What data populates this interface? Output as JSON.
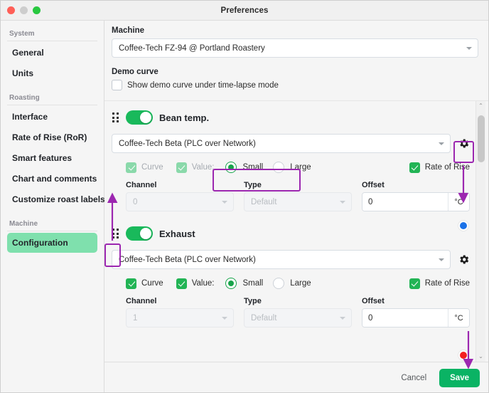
{
  "window": {
    "title": "Preferences",
    "controls": [
      "close-red",
      "minimize-grey",
      "zoom-green"
    ]
  },
  "sidebar": {
    "groups": [
      {
        "label": "System",
        "items": [
          {
            "label": "General",
            "active": false
          },
          {
            "label": "Units",
            "active": false
          }
        ]
      },
      {
        "label": "Roasting",
        "items": [
          {
            "label": "Interface",
            "active": false
          },
          {
            "label": "Rate of Rise (RoR)",
            "active": false
          },
          {
            "label": "Smart features",
            "active": false
          },
          {
            "label": "Chart and comments",
            "active": false
          },
          {
            "label": "Customize roast labels",
            "active": false
          }
        ]
      },
      {
        "label": "Machine",
        "items": [
          {
            "label": "Configuration",
            "active": true
          }
        ]
      }
    ]
  },
  "main": {
    "machine": {
      "label": "Machine",
      "value": "Coffee-Tech FZ-94 @ Portland Roastery"
    },
    "demo": {
      "label": "Demo curve",
      "checkbox_label": "Show demo curve under time-lapse mode",
      "checked": false
    }
  },
  "devices": [
    {
      "name": "Bean temp.",
      "enabled": true,
      "source": "Coffee-Tech Beta (PLC over Network)",
      "dot_color": "#1b72e8",
      "curve": {
        "label": "Curve",
        "checked": true,
        "disabled": true
      },
      "value": {
        "label": "Value:",
        "checked": true,
        "disabled": true
      },
      "size": {
        "selected": "Small",
        "options": [
          "Small",
          "Large"
        ]
      },
      "rate_of_rise": {
        "label": "Rate of Rise",
        "checked": true
      },
      "channel": {
        "label": "Channel",
        "value": "0",
        "disabled": true
      },
      "type": {
        "label": "Type",
        "value": "Default",
        "disabled": true
      },
      "offset": {
        "label": "Offset",
        "value": "0",
        "unit": "°C"
      }
    },
    {
      "name": "Exhaust",
      "enabled": true,
      "source": "Coffee-Tech Beta (PLC over Network)",
      "dot_color": "#f42020",
      "curve": {
        "label": "Curve",
        "checked": true,
        "disabled": false
      },
      "value": {
        "label": "Value:",
        "checked": true,
        "disabled": false
      },
      "size": {
        "selected": "Small",
        "options": [
          "Small",
          "Large"
        ]
      },
      "rate_of_rise": {
        "label": "Rate of Rise",
        "checked": true
      },
      "channel": {
        "label": "Channel",
        "value": "1",
        "disabled": true
      },
      "type": {
        "label": "Type",
        "value": "Default",
        "disabled": true
      },
      "offset": {
        "label": "Offset",
        "value": "0",
        "unit": "°C"
      }
    }
  ],
  "scrollbar": {
    "up_glyph": "⌃",
    "down_glyph": "⌄"
  },
  "footer": {
    "cancel_label": "Cancel",
    "save_label": "Save"
  },
  "annotations": {
    "highlight_color": "#9c27b0"
  }
}
